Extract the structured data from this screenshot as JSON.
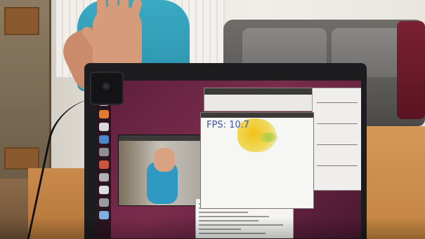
{
  "photo": {
    "on_screen": {
      "fps_window": {
        "fps_text": "FPS: 10.7"
      }
    }
  }
}
